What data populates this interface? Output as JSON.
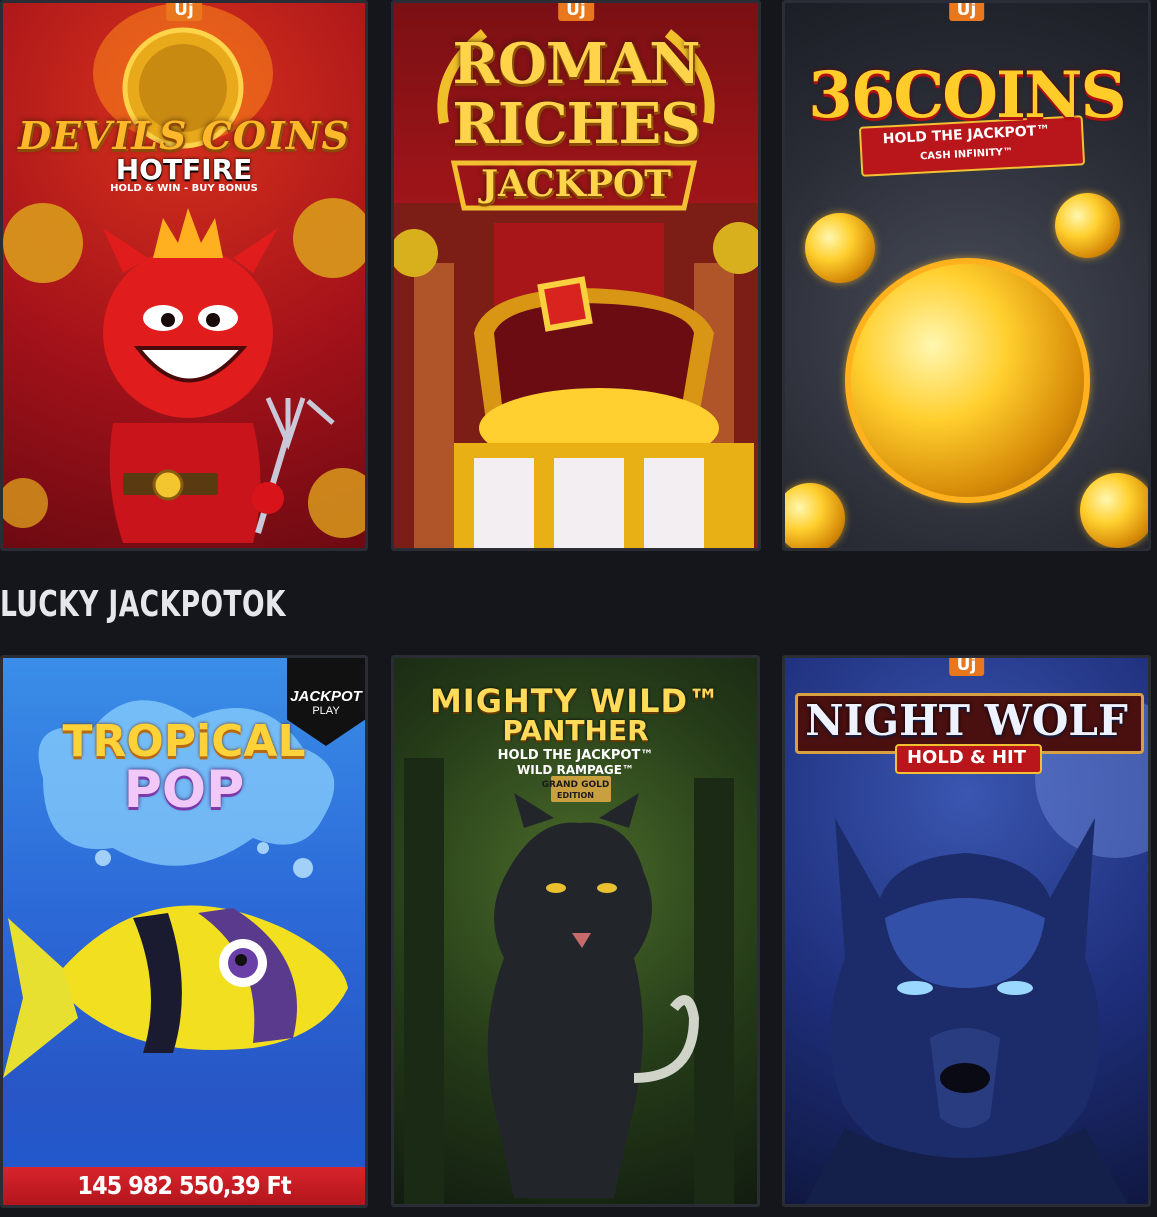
{
  "new_badge": "Új",
  "section_title": "LUCKY JACKPOTOK",
  "games_top": [
    {
      "title": "DEVILS COINS",
      "subtitle": "HOTFIRE",
      "tagline": "HOLD & WIN - BUY BONUS",
      "badge": "Új"
    },
    {
      "title_line1": "ROMAN",
      "title_line2": "RICHES",
      "subtitle": "JACKPOT",
      "badge": "Új"
    },
    {
      "title": "36COINS",
      "subtitle": "HOLD THE JACKPOT™",
      "tagline": "CASH INFINITY™",
      "badge": "Új"
    }
  ],
  "games_bottom": [
    {
      "title_line1": "TROPiCAL",
      "title_line2": "POP",
      "provider_line1": "JACKPOT",
      "provider_line2": "PLAY",
      "jackpot_amount": "145 982 550,39 Ft"
    },
    {
      "title_line1": "MIGHTY WILD™",
      "title_line2": "PANTHER",
      "subtitle_line1": "HOLD THE JACKPOT™",
      "subtitle_line2": "WILD RAMPAGE™",
      "edition_line1": "GRAND GOLD",
      "edition_line2": "EDITION"
    },
    {
      "title": "NIGHT WOLF",
      "subtitle": "HOLD & HIT",
      "badge": "Új"
    }
  ]
}
